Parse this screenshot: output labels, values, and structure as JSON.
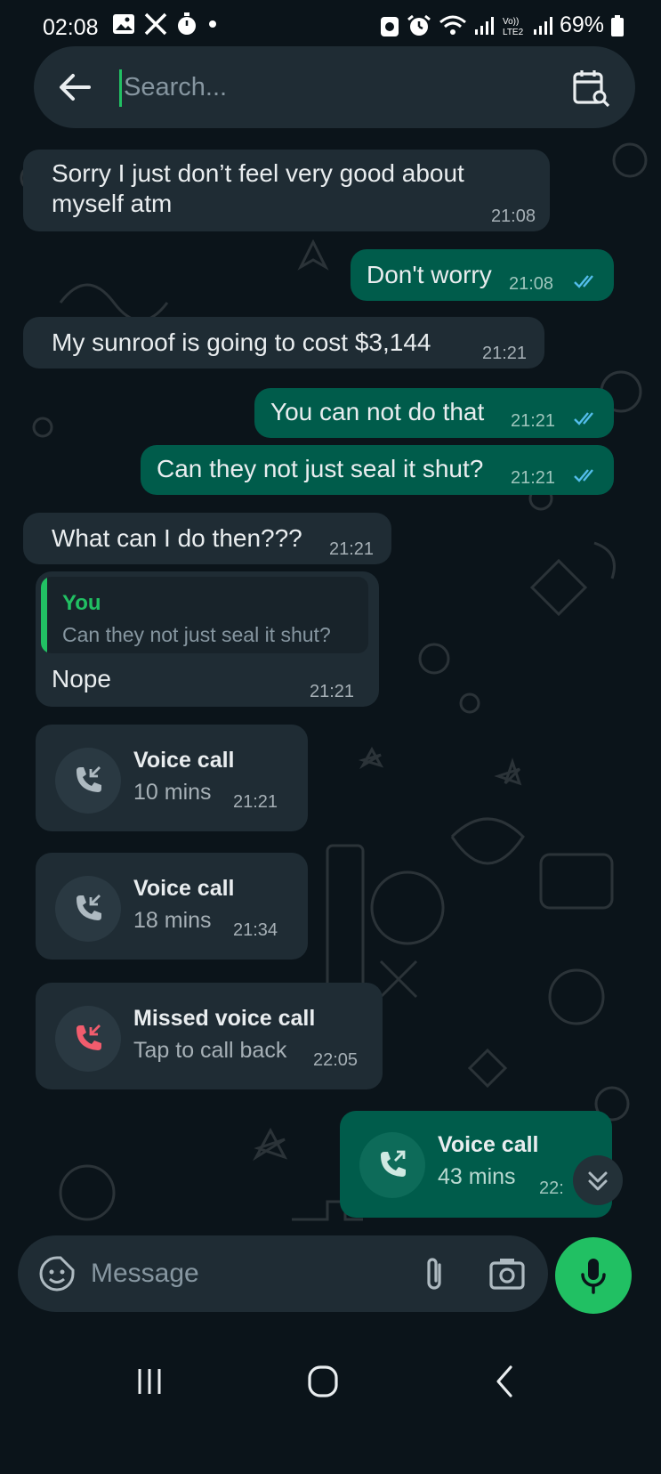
{
  "status_bar": {
    "time": "02:08",
    "battery": "69%",
    "left_icons": [
      "gallery-icon",
      "x-logo-icon",
      "timer-icon",
      "dot-icon"
    ],
    "right_icons": [
      "battery-saver-icon",
      "alarm-icon",
      "wifi-icon",
      "signal-icon",
      "volte-icon",
      "signal-icon",
      "battery-icon"
    ],
    "volte_label": "Vo))\nLTE2"
  },
  "search": {
    "placeholder": "Search..."
  },
  "messages": [
    {
      "direction": "in",
      "text": "Sorry I just don’t feel very good about\nmyself atm",
      "time": "21:08"
    },
    {
      "direction": "out",
      "text": "Don't worry",
      "time": "21:08",
      "status": "read"
    },
    {
      "direction": "in",
      "text": "My sunroof is going to cost $3,144",
      "time": "21:21"
    },
    {
      "direction": "out",
      "text": "You can not do that",
      "time": "21:21",
      "status": "read"
    },
    {
      "direction": "out",
      "text": "Can they not just seal it shut?",
      "time": "21:21",
      "status": "read"
    },
    {
      "direction": "in",
      "text": "What can I do then???",
      "time": "21:21"
    },
    {
      "direction": "in",
      "quote_author": "You",
      "quote_text": "Can they not just seal it shut?",
      "text": "Nope",
      "time": "21:21"
    },
    {
      "direction": "in",
      "type": "call",
      "title": "Voice call",
      "subtitle": "10 mins",
      "time": "21:21"
    },
    {
      "direction": "in",
      "type": "call",
      "title": "Voice call",
      "subtitle": "18 mins",
      "time": "21:34"
    },
    {
      "direction": "in",
      "type": "missed-call",
      "title": "Missed voice call",
      "subtitle": "Tap to call back",
      "time": "22:05"
    },
    {
      "direction": "out",
      "type": "call",
      "title": "Voice call",
      "subtitle": "43 mins",
      "time": "22:"
    }
  ],
  "compose": {
    "placeholder": "Message"
  },
  "colors": {
    "background": "#0b141a",
    "incoming_bubble": "#1f2c34",
    "outgoing_bubble": "#005c4b",
    "accent": "#21c063",
    "read_ticks": "#53bdeb",
    "missed_call": "#f15c6d"
  }
}
